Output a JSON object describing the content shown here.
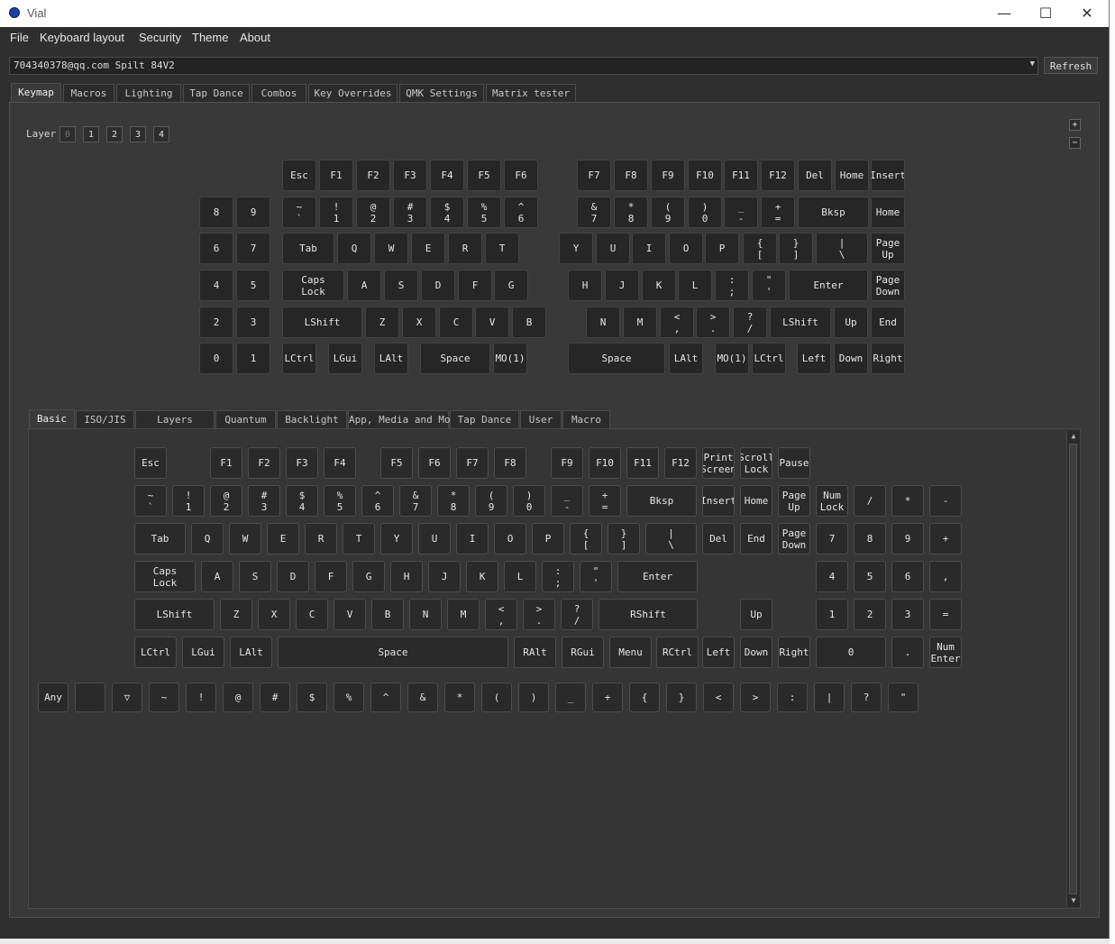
{
  "window": {
    "title": "Vial",
    "minimize": "—",
    "maximize": "☐",
    "close": "✕"
  },
  "menu": [
    "File",
    "Keyboard layout",
    "Security",
    "Theme",
    "About"
  ],
  "device": {
    "selected": "704340378@qq.com Spilt 84V2",
    "refresh_label": "Refresh"
  },
  "main_tabs": [
    "Keymap",
    "Macros",
    "Lighting",
    "Tap Dance",
    "Combos",
    "Key Overrides",
    "QMK Settings",
    "Matrix tester"
  ],
  "layers": {
    "label": "Layer",
    "items": [
      "0",
      "1",
      "2",
      "3",
      "4"
    ],
    "selected": "0"
  },
  "side_buttons": [
    "+",
    "−"
  ],
  "keyboard_keys": [
    "Esc",
    "F1",
    "F2",
    "F3",
    "F4",
    "F5",
    "F6",
    "F7",
    "F8",
    "F9",
    "F10",
    "F11",
    "F12",
    "Del",
    "Home",
    "Insert",
    "8",
    "9",
    "~\n`",
    "!\n1",
    "@\n2",
    "#\n3",
    "$\n4",
    "%\n5",
    "^\n6",
    "&\n7",
    "*\n8",
    "(\n9",
    ")\n0",
    "_\n-",
    "+\n=",
    "Bksp",
    "Home",
    "6",
    "7",
    "Tab",
    "Q",
    "W",
    "E",
    "R",
    "T",
    "Y",
    "U",
    "I",
    "O",
    "P",
    "{\n[",
    "}\n]",
    "|\n\\",
    "Page\nUp",
    "4",
    "5",
    "Caps\nLock",
    "A",
    "S",
    "D",
    "F",
    "G",
    "H",
    "J",
    "K",
    "L",
    ":\n;",
    "\"\n'",
    "Enter",
    "Page\nDown",
    "2",
    "3",
    "LShift",
    "Z",
    "X",
    "C",
    "V",
    "B",
    "N",
    "M",
    "<\n,",
    ">\n.",
    "?\n/",
    "LShift",
    "Up",
    "End",
    "0",
    "1",
    "LCtrl",
    "LGui",
    "LAlt",
    "Space",
    "MO(1)",
    "Space",
    "LAlt",
    "MO(1)",
    "LCtrl",
    "Left",
    "Down",
    "Right"
  ],
  "sub_tabs": [
    "Basic",
    "ISO/JIS",
    "Layers",
    "Quantum",
    "Backlight",
    "App, Media and Mouse",
    "Tap Dance",
    "User",
    "Macro"
  ],
  "basic_keys": [
    "Esc",
    "F1",
    "F2",
    "F3",
    "F4",
    "F5",
    "F6",
    "F7",
    "F8",
    "F9",
    "F10",
    "F11",
    "F12",
    "Print\nScreen",
    "Scroll\nLock",
    "Pause",
    "~\n`",
    "!\n1",
    "@\n2",
    "#\n3",
    "$\n4",
    "%\n5",
    "^\n6",
    "&\n7",
    "*\n8",
    "(\n9",
    ")\n0",
    "_\n-",
    "+\n=",
    "Bksp",
    "Insert",
    "Home",
    "Page\nUp",
    "Num\nLock",
    "/",
    "*",
    "-",
    "Tab",
    "Q",
    "W",
    "E",
    "R",
    "T",
    "Y",
    "U",
    "I",
    "O",
    "P",
    "{\n[",
    "}\n]",
    "|\n\\",
    "Del",
    "End",
    "Page\nDown",
    "7",
    "8",
    "9",
    "+",
    "Caps\nLock",
    "A",
    "S",
    "D",
    "F",
    "G",
    "H",
    "J",
    "K",
    "L",
    ":\n;",
    "\"\n'",
    "Enter",
    "4",
    "5",
    "6",
    ",",
    "LShift",
    "Z",
    "X",
    "C",
    "V",
    "B",
    "N",
    "M",
    "<\n,",
    ">\n.",
    "?\n/",
    "RShift",
    "Up",
    "1",
    "2",
    "3",
    "=",
    "LCtrl",
    "LGui",
    "LAlt",
    "Space",
    "RAlt",
    "RGui",
    "Menu",
    "RCtrl",
    "Left",
    "Down",
    "Right",
    "0",
    ".",
    "Num\nEnter"
  ],
  "extra_keys": [
    "Any",
    "",
    "▽",
    "~",
    "!",
    "@",
    "#",
    "$",
    "%",
    "^",
    "&",
    "*",
    "(",
    ")",
    "_",
    "+",
    "{",
    "}",
    "<",
    ">",
    ":",
    "|",
    "?",
    "\""
  ]
}
